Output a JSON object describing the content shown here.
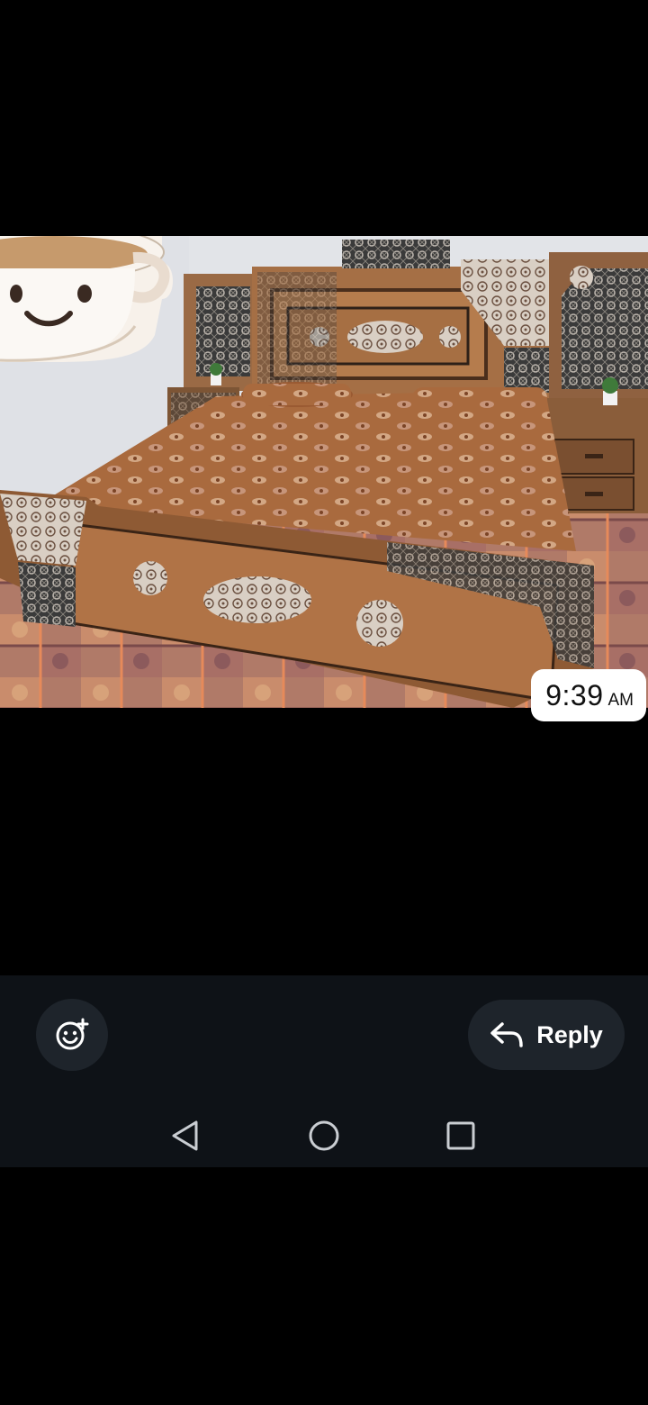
{
  "message": {
    "time": "9:39",
    "ampm": "AM"
  },
  "actions": {
    "reply_label": "Reply"
  },
  "icons": {
    "emoji": "add-emoji-reaction-icon",
    "reply": "reply-arrow-icon",
    "nav_back": "back-triangle-icon",
    "nav_home": "home-circle-icon",
    "nav_recents": "recents-square-icon",
    "sticker": "smiling-coffee-cup-sticker"
  },
  "colors": {
    "background": "#000000",
    "panel": "#0e1217",
    "button": "#1e242b",
    "text": "#ffffff"
  }
}
